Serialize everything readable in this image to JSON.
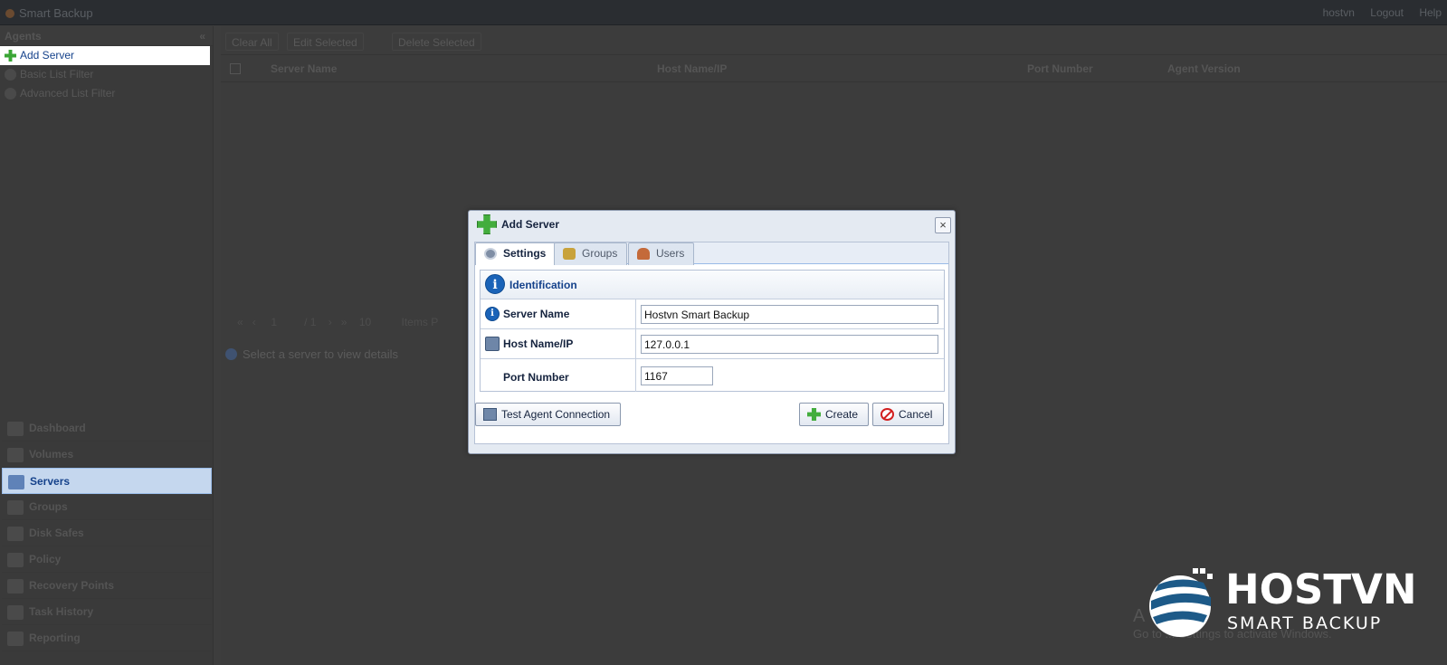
{
  "app": {
    "title": "Smart Backup",
    "top_right": [
      "hostvn",
      "Logout",
      "Help"
    ]
  },
  "sidebar": {
    "header": "Agents",
    "links": [
      {
        "label": "Add Server",
        "icon": "add-icon",
        "active": true
      },
      {
        "label": "Basic List Filter",
        "icon": "filter-icon"
      },
      {
        "label": "Advanced List Filter",
        "icon": "advanced-filter-icon"
      }
    ],
    "nav": [
      {
        "label": "Dashboard",
        "icon": "dashboard-icon"
      },
      {
        "label": "Volumes",
        "icon": "volumes-icon"
      },
      {
        "label": "Servers",
        "icon": "servers-icon",
        "active": true
      },
      {
        "label": "Groups",
        "icon": "groups-icon"
      },
      {
        "label": "Disk Safes",
        "icon": "disk-safes-icon"
      },
      {
        "label": "Policy",
        "icon": "policy-icon"
      },
      {
        "label": "Recovery Points",
        "icon": "recovery-points-icon"
      },
      {
        "label": "Task History",
        "icon": "task-history-icon"
      },
      {
        "label": "Reporting",
        "icon": "reporting-icon"
      }
    ]
  },
  "main": {
    "toolbar": {
      "clear_all": "Clear All",
      "edit_selected": "Edit Selected",
      "delete_selected": "Delete Selected"
    },
    "grid": {
      "columns": [
        "Server Name",
        "Host Name/IP",
        "Port Number",
        "Agent Version"
      ]
    },
    "pager": {
      "page": "1",
      "of": "/ 1",
      "page_size": "10",
      "items_label": "Items P"
    },
    "detail_message": "Select a server to view details"
  },
  "activation": {
    "line1": "A",
    "line2": "Go to ... Settings to activate Windows."
  },
  "logo": {
    "brand": "HOSTVN",
    "product": "SMART BACKUP"
  },
  "dialog": {
    "title": "Add Server",
    "tabs": [
      {
        "label": "Settings",
        "icon": "gear-icon",
        "active": true
      },
      {
        "label": "Groups",
        "icon": "groups-icon"
      },
      {
        "label": "Users",
        "icon": "users-icon"
      }
    ],
    "section": "Identification",
    "fields": {
      "server_name": {
        "label": "Server Name",
        "value": "Hostvn Smart Backup"
      },
      "host": {
        "label": "Host Name/IP",
        "value": "127.0.0.1"
      },
      "port": {
        "label": "Port Number",
        "value": "1167"
      }
    },
    "buttons": {
      "test": "Test Agent Connection",
      "create": "Create",
      "cancel": "Cancel"
    },
    "colors": {
      "accent": "#15428b",
      "create_icon": "#43ad3d",
      "cancel_icon": "#d21f1f"
    }
  }
}
